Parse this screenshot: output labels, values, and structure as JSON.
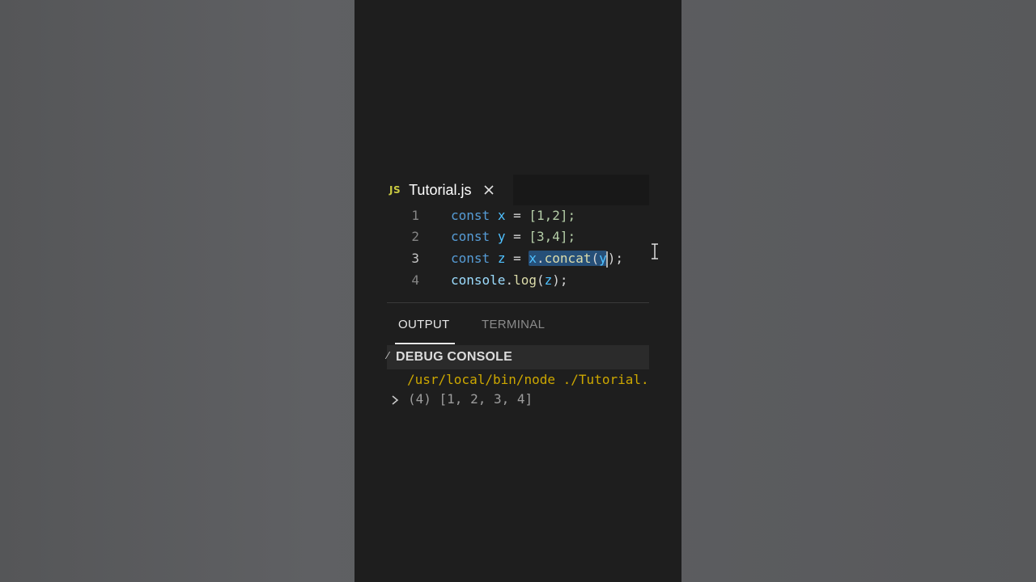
{
  "editor": {
    "tab": {
      "icon": "js-file-icon",
      "icon_text": "JS",
      "title": "Tutorial.js",
      "close": "close-icon"
    },
    "lines": [
      {
        "number": "1",
        "tokens": {
          "kw": "const",
          "name": "x",
          "op": "=",
          "value": "[1,2];"
        }
      },
      {
        "number": "2",
        "tokens": {
          "kw": "const",
          "name": "y",
          "op": "=",
          "value": "[3,4];"
        }
      },
      {
        "number": "3",
        "tokens": {
          "kw": "const",
          "name": "z",
          "op": "=",
          "obj": "x",
          "dot": ".",
          "method": "concat",
          "open": "(",
          "arg": "y",
          "close": ");"
        }
      },
      {
        "number": "4",
        "tokens": {
          "obj": "console",
          "dot": ".",
          "method": "log",
          "open": "(",
          "arg": "z",
          "close": ");"
        }
      }
    ],
    "active_line": "3",
    "selection": "x.concat(y"
  },
  "panel": {
    "tabs": [
      {
        "label": "OUTPUT",
        "active": true
      },
      {
        "label": "TERMINAL",
        "active": false
      }
    ],
    "section_title": "DEBUG CONSOLE",
    "console": {
      "command": "/usr/local/bin/node ./Tutorial.js",
      "result": "(4) [1, 2, 3, 4]"
    }
  },
  "colors": {
    "keyword": "#569cd6",
    "variable": "#4fc1ff",
    "number": "#b5cea8",
    "function": "#dcdcaa",
    "selection": "#264f78",
    "console_path": "#cca700"
  }
}
